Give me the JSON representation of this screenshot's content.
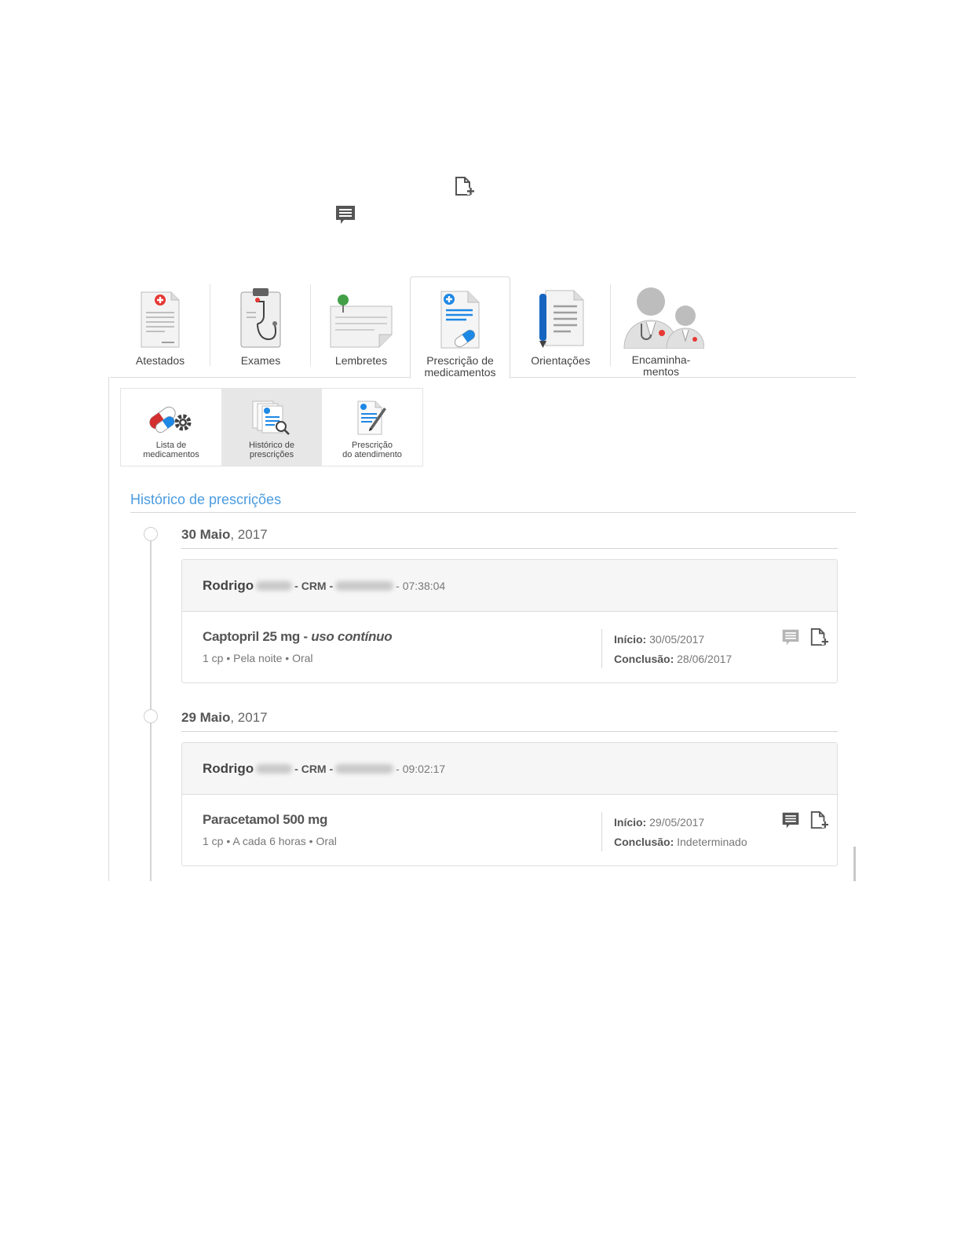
{
  "tabs": [
    {
      "label": "Atestados"
    },
    {
      "label": "Exames"
    },
    {
      "label": "Lembretes"
    },
    {
      "label_line1": "Prescrição de",
      "label_line2": "medicamentos"
    },
    {
      "label": "Orientações"
    },
    {
      "label_line1": "Encaminha-",
      "label_line2": "mentos"
    }
  ],
  "subtabs": [
    {
      "label_line1": "Lista de",
      "label_line2": "medicamentos"
    },
    {
      "label_line1": "Histórico de",
      "label_line2": "prescrições"
    },
    {
      "label_line1": "Prescrição",
      "label_line2": "do atendimento"
    }
  ],
  "section_title": "Histórico de prescrições",
  "entries": [
    {
      "date_bold": "30 Maio",
      "date_rest": ", 2017",
      "doctor": "Rodrigo",
      "crm_label": "- CRM -",
      "time": "- 07:38:04",
      "medication": "Captopril 25 mg -",
      "medication_note": "uso contínuo",
      "dosage": "1 cp • Pela noite • Oral",
      "start_label": "Início:",
      "start_value": "30/05/2017",
      "end_label": "Conclusão:",
      "end_value": "28/06/2017"
    },
    {
      "date_bold": "29 Maio",
      "date_rest": ", 2017",
      "doctor": "Rodrigo",
      "crm_label": "- CRM -",
      "time": "- 09:02:17",
      "medication": "Paracetamol 500 mg",
      "medication_note": "",
      "dosage": "1 cp • A cada 6 horas • Oral",
      "start_label": "Início:",
      "start_value": "29/05/2017",
      "end_label": "Conclusão:",
      "end_value": "Indeterminado"
    }
  ],
  "colors": {
    "accent": "#4a9be0",
    "comment_icon_muted": "#b5b5b5",
    "comment_icon_dark": "#555555"
  },
  "icons": {
    "float_top": "add-document-icon",
    "float_second": "comment-icon"
  }
}
